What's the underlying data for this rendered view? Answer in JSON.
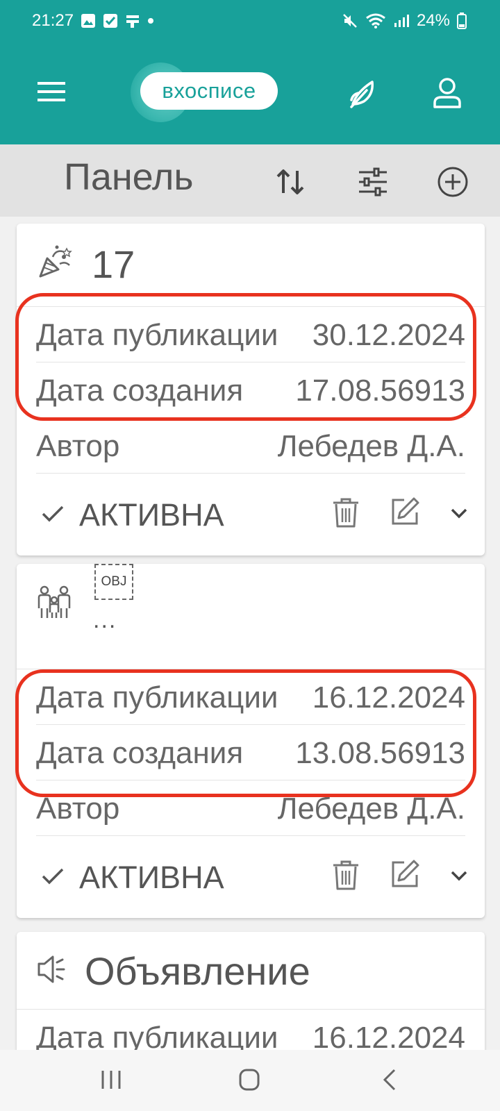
{
  "status_bar": {
    "time": "21:27",
    "battery": "24%",
    "icons": [
      "image-icon",
      "checkbox-icon",
      "signal-icon",
      "dot-icon",
      "mute-icon",
      "wifi-icon",
      "cell-signal-icon",
      "battery-icon"
    ]
  },
  "app_bar": {
    "logo_text": "вхосписе",
    "icons": [
      "menu-icon",
      "leaf-icon",
      "user-icon"
    ]
  },
  "toolbar": {
    "title": "Панель",
    "icons": [
      "sort-icon",
      "filter-icon",
      "add-circle-icon"
    ]
  },
  "cards": [
    {
      "title": "17",
      "icon": "party-popper-icon",
      "rows": [
        {
          "label": "Дата публикации",
          "value": "30.12.2024"
        },
        {
          "label": "Дата создания",
          "value": "17.08.56913"
        },
        {
          "label": "Автор",
          "value": "Лебедев Д.А."
        }
      ],
      "status": "АКТИВНА"
    },
    {
      "title": "...",
      "icon": "family-icon",
      "badge": "OBJ",
      "rows": [
        {
          "label": "Дата публикации",
          "value": "16.12.2024"
        },
        {
          "label": "Дата создания",
          "value": "13.08.56913"
        },
        {
          "label": "Автор",
          "value": "Лебедев Д.А."
        }
      ],
      "status": "АКТИВНА"
    },
    {
      "title": "Объявление",
      "icon": "megaphone-icon",
      "rows": [
        {
          "label": "Дата публикации",
          "value": "16.12.2024"
        }
      ]
    }
  ],
  "colors": {
    "primary": "#18a19a",
    "highlight": "#e8321f",
    "toolbar_bg": "#e2e2e2"
  }
}
